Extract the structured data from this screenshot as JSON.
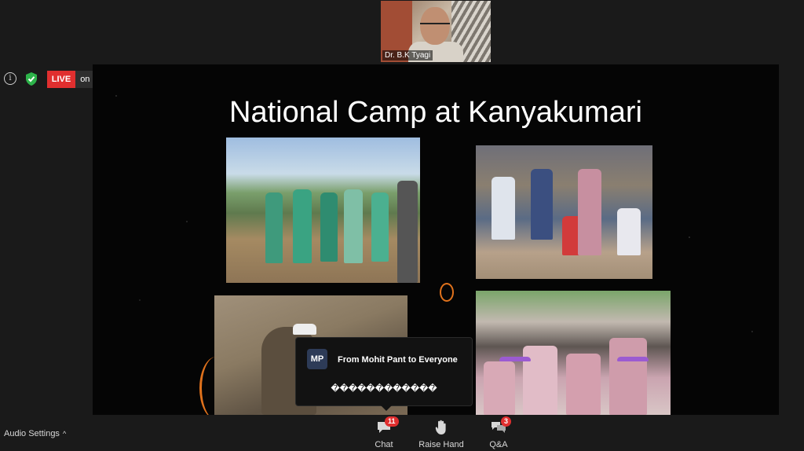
{
  "speaker": {
    "name": "Dr. B.K Tyagi"
  },
  "status": {
    "info_icon": "info-icon",
    "shield_icon": "shield-check-icon",
    "live_label": "LIVE",
    "live_destination": "on Facebook",
    "live_color": "#e02f2f"
  },
  "slide": {
    "title": "National Camp at Kanyakumari",
    "photos": [
      "children-eclipse-glasses",
      "crowd-observers",
      "rock-closeup",
      "students-viewing-eclipse"
    ]
  },
  "chat_popup": {
    "avatar_initials": "MP",
    "from": "From Mohit Pant to Everyone",
    "message": "������������"
  },
  "toolbar": {
    "audio_settings": "Audio Settings",
    "audio_caret": "^",
    "chat_label": "Chat",
    "chat_badge": "11",
    "raise_hand_label": "Raise Hand",
    "qa_label": "Q&A",
    "qa_badge": "3"
  }
}
